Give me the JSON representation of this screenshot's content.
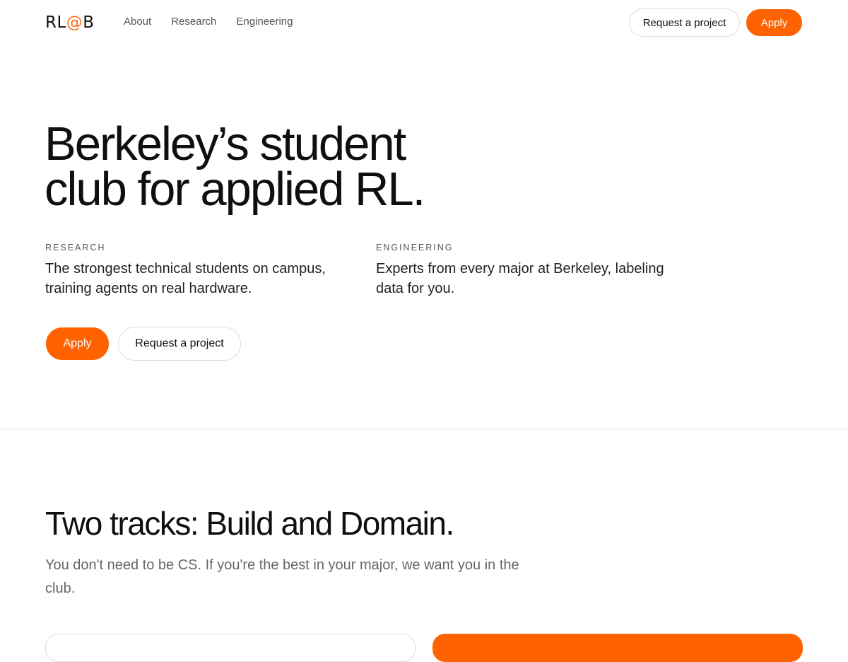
{
  "nav": {
    "logo_prefix": "RL",
    "logo_at": "@",
    "logo_suffix": "B",
    "links": [
      "About",
      "Research",
      "Engineering"
    ],
    "request_label": "Request a project",
    "apply_label": "Apply"
  },
  "hero": {
    "title_line1": "Berkeley’s student",
    "title_line2": "club for applied RL.",
    "research": {
      "eyebrow": "RESEARCH",
      "body": "The strongest technical students on campus, training agents on real hardware."
    },
    "engineering": {
      "eyebrow": "ENGINEERING",
      "body": "Experts from every major at Berkeley, labeling data for you."
    },
    "apply_label": "Apply",
    "request_label": "Request a project"
  },
  "tracks": {
    "title": "Two tracks: Build and Domain.",
    "subtitle": "You don't need to be CS. If you're the best in your major, we want you in the club."
  },
  "colors": {
    "accent": "#ff6200",
    "text": "#111111",
    "muted": "#666666",
    "border": "#dddddd"
  }
}
